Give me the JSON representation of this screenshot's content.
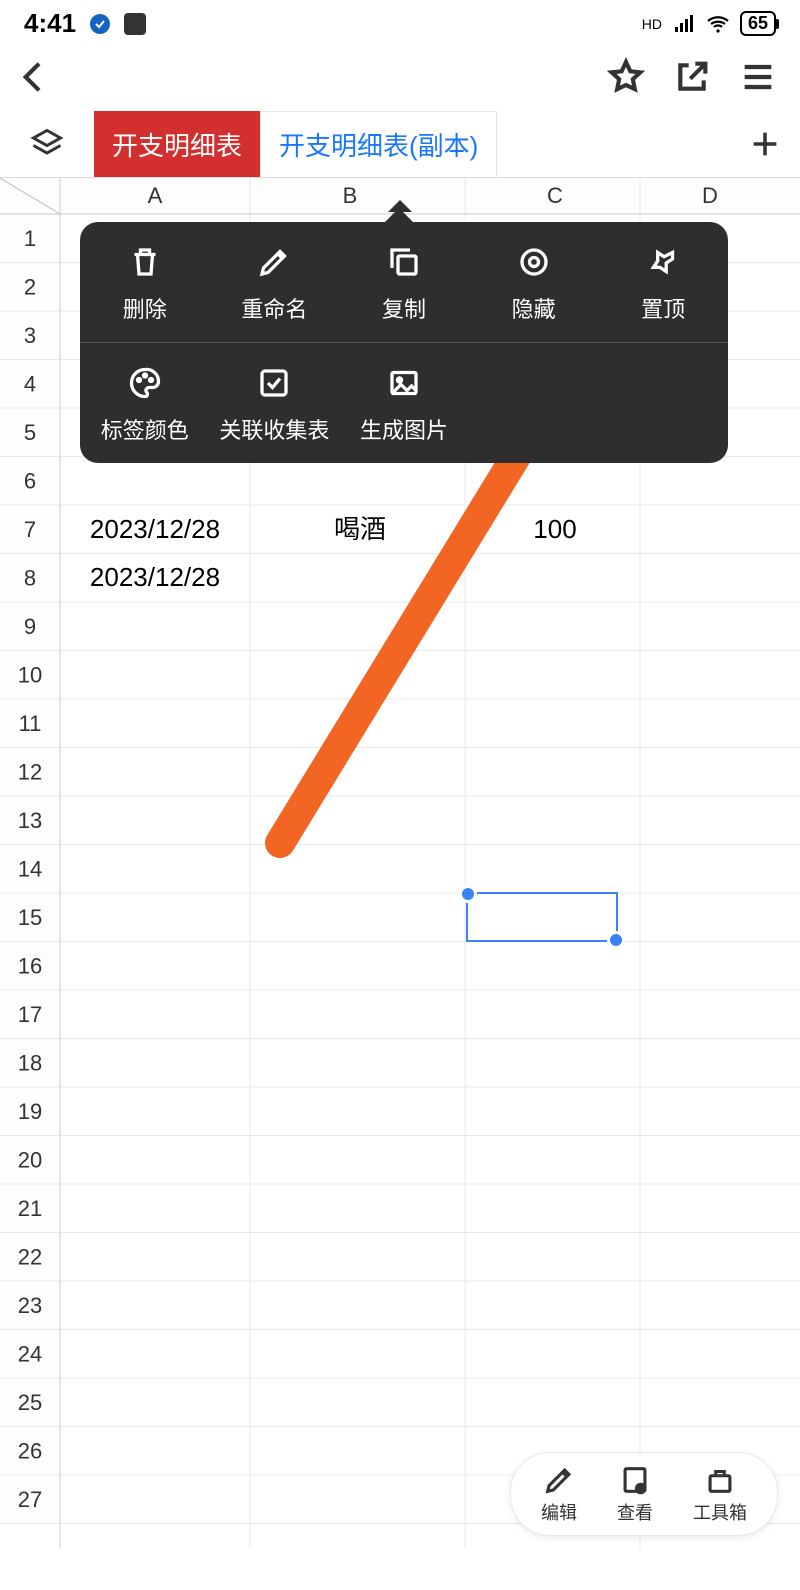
{
  "status": {
    "time": "4:41",
    "hd": "HD",
    "battery": "65"
  },
  "tabs": {
    "active": "开支明细表",
    "inactive": "开支明细表(副本)"
  },
  "columns": [
    "A",
    "B",
    "C",
    "D"
  ],
  "rows": [
    "1",
    "2",
    "3",
    "4",
    "5",
    "6",
    "7",
    "8",
    "9",
    "10",
    "11",
    "12",
    "13",
    "14",
    "15",
    "16",
    "17",
    "18",
    "19",
    "20",
    "21",
    "22",
    "23",
    "24",
    "25",
    "26",
    "27"
  ],
  "data": {
    "r7a": "2023/12/28",
    "r7b": "喝酒",
    "r7c": "100",
    "r8a": "2023/12/28"
  },
  "ctx": {
    "delete": "删除",
    "rename": "重命名",
    "copy": "复制",
    "hide": "隐藏",
    "pin": "置顶",
    "color": "标签颜色",
    "link": "关联收集表",
    "image": "生成图片"
  },
  "bottom": {
    "edit": "编辑",
    "view": "查看",
    "tools": "工具箱"
  }
}
